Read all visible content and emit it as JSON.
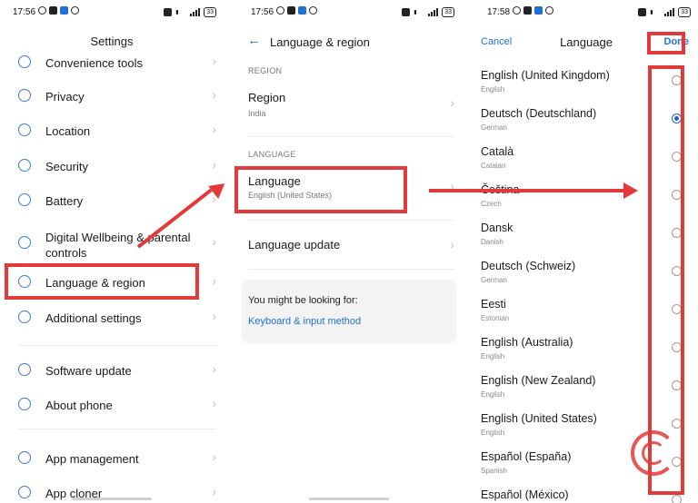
{
  "colors": {
    "accent": "#1a63d8",
    "annotation": "#e23a3a",
    "link": "#1f6fd6"
  },
  "panel1": {
    "status_time": "17:56",
    "battery": "33",
    "title": "Settings",
    "rows": [
      {
        "label": "Convenience tools",
        "icon": "convenience-icon"
      },
      {
        "label": "Privacy",
        "icon": "privacy-icon"
      },
      {
        "label": "Location",
        "icon": "location-icon"
      },
      {
        "label": "Security",
        "icon": "security-icon"
      },
      {
        "label": "Battery",
        "icon": "battery-icon"
      },
      {
        "label": "Digital Wellbeing & parental controls",
        "icon": "wellbeing-icon"
      },
      {
        "label": "Language & region",
        "icon": "language-icon"
      },
      {
        "label": "Additional settings",
        "icon": "additional-settings-icon"
      },
      {
        "label": "Software update",
        "icon": "update-icon"
      },
      {
        "label": "About phone",
        "icon": "info-icon"
      },
      {
        "label": "App management",
        "icon": "apps-icon"
      },
      {
        "label": "App cloner",
        "icon": "cloner-icon"
      }
    ]
  },
  "panel2": {
    "status_time": "17:56",
    "battery": "33",
    "title": "Language & region",
    "section_region": "REGION",
    "region_label": "Region",
    "region_value": "India",
    "section_language": "LANGUAGE",
    "language_label": "Language",
    "language_value": "English (United States)",
    "language_update": "Language update",
    "suggest_text": "You might be looking for:",
    "suggest_link": "Keyboard & input method"
  },
  "panel3": {
    "status_time": "17:58",
    "battery": "33",
    "cancel": "Cancel",
    "title": "Language",
    "done": "Done",
    "languages": [
      {
        "name": "English (United Kingdom)",
        "sub": "English",
        "selected": false
      },
      {
        "name": "Deutsch (Deutschland)",
        "sub": "German",
        "selected": true
      },
      {
        "name": "Català",
        "sub": "Catalan",
        "selected": false
      },
      {
        "name": "Čeština",
        "sub": "Czech",
        "selected": false
      },
      {
        "name": "Dansk",
        "sub": "Danish",
        "selected": false
      },
      {
        "name": "Deutsch (Schweiz)",
        "sub": "German",
        "selected": false
      },
      {
        "name": "Eesti",
        "sub": "Estonian",
        "selected": false
      },
      {
        "name": "English (Australia)",
        "sub": "English",
        "selected": false
      },
      {
        "name": "English (New Zealand)",
        "sub": "English",
        "selected": false
      },
      {
        "name": "English (United States)",
        "sub": "English",
        "selected": false
      },
      {
        "name": "Español (España)",
        "sub": "Spanish",
        "selected": false
      },
      {
        "name": "Español (México)",
        "sub": "",
        "selected": false
      }
    ]
  }
}
